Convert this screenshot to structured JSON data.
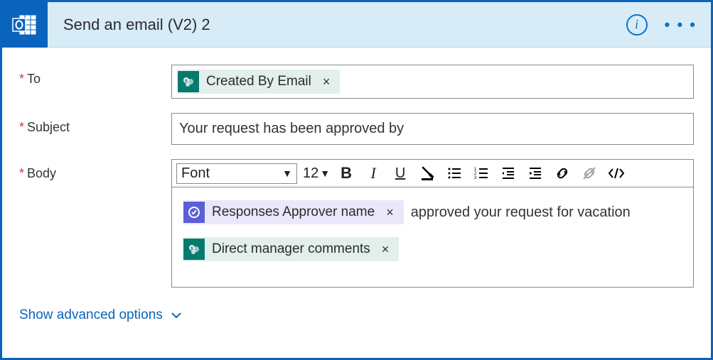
{
  "header": {
    "title": "Send an email (V2) 2",
    "info_glyph": "i",
    "more_glyph": "• • •"
  },
  "fields": {
    "to": {
      "label": "To",
      "required": true,
      "tokens": [
        {
          "kind": "sp",
          "label": "Created By Email"
        }
      ]
    },
    "subject": {
      "label": "Subject",
      "required": true,
      "value": "Your request has been approved by"
    },
    "body": {
      "label": "Body",
      "required": true,
      "toolbar": {
        "font": "Font",
        "size": "12"
      },
      "content": {
        "line1_token": {
          "kind": "appr",
          "label": "Responses Approver name"
        },
        "line1_text": "approved your request for vacation",
        "line2_token": {
          "kind": "sp",
          "label": "Direct manager comments"
        }
      }
    }
  },
  "advanced": {
    "label": "Show advanced options"
  }
}
